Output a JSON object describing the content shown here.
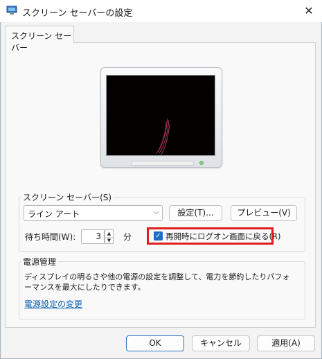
{
  "window": {
    "title": "スクリーン セーバーの設定",
    "close_glyph": "✕"
  },
  "tab": {
    "label": "スクリーン セーバー"
  },
  "screensaver_group": {
    "label": "スクリーン セーバー(S)",
    "selected": "ライン アート",
    "settings_button": "設定(T)...",
    "preview_button": "プレビュー(V)"
  },
  "wait": {
    "label": "待ち時間(W):",
    "value": "3",
    "unit": "分",
    "resume_checkbox_label": "再開時にログオン画面に戻る(R)",
    "resume_checked": true
  },
  "power_group": {
    "label": "電源管理",
    "description_line1": "ディスプレイの明るさや他の電源の設定を調整して、電力を節約したりパフォ",
    "description_line2": "ーマンスを最大にしたりできます。",
    "link": "電源設定の変更"
  },
  "footer": {
    "ok": "OK",
    "cancel": "キャンセル",
    "apply": "適用(A)"
  },
  "colors": {
    "highlight": "#e21d1d",
    "accent": "#1a6dc8",
    "link": "#0b5fb3"
  }
}
